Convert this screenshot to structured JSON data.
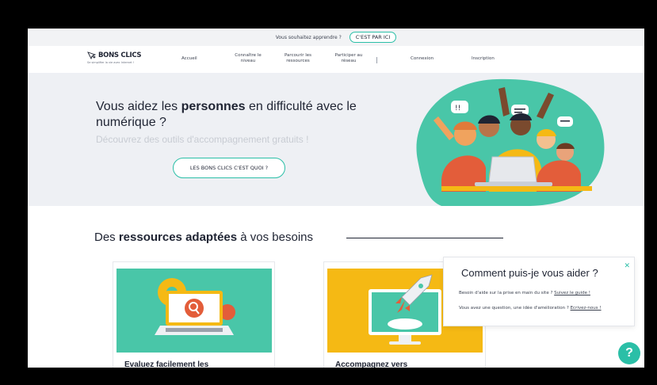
{
  "topbar": {
    "prompt": "Vous souhaitez apprendre ?",
    "cta": "C'EST PAR ICI"
  },
  "nav": {
    "logo_text": "BONS CLICS",
    "logo_tagline": "Se simplifier la vie avec Internet !",
    "items": [
      {
        "label": "Accueil"
      },
      {
        "label": "Connaître le niveau"
      },
      {
        "label": "Parcourir les ressources"
      },
      {
        "label": "Participer au réseau"
      },
      {
        "label": "Connexion"
      },
      {
        "label": "Inscription"
      }
    ]
  },
  "hero": {
    "title_before": "Vous aidez les ",
    "title_bold": "personnes",
    "title_after": " en difficulté avec le numérique ?",
    "subtitle": "Découvrez des outils d'accompagnement gratuits !",
    "button": "LES BONS CLICS C'EST QUOI ?"
  },
  "resources": {
    "title_before": "Des ",
    "title_bold": "ressources adaptées",
    "title_after": " à vos besoins",
    "cards": [
      {
        "caption": "Evaluez facilement les",
        "color": "#49c6a8"
      },
      {
        "caption": "Accompagnez vers",
        "color": "#f5b914"
      }
    ]
  },
  "help": {
    "title": "Comment puis-je vous aider ?",
    "close_icon": "close-icon",
    "line1_text": "Besoin d'aide sur la prise en main du site ?",
    "line1_link": "Suivez le guide !",
    "line2_text": "Vous avez une question, une idée d'amélioration ?",
    "line2_link": "Ecrivez-nous !",
    "fab": "?"
  },
  "colors": {
    "accent": "#2bbfa7",
    "hero_bg": "#eef0f4",
    "yellow": "#f5b914"
  }
}
